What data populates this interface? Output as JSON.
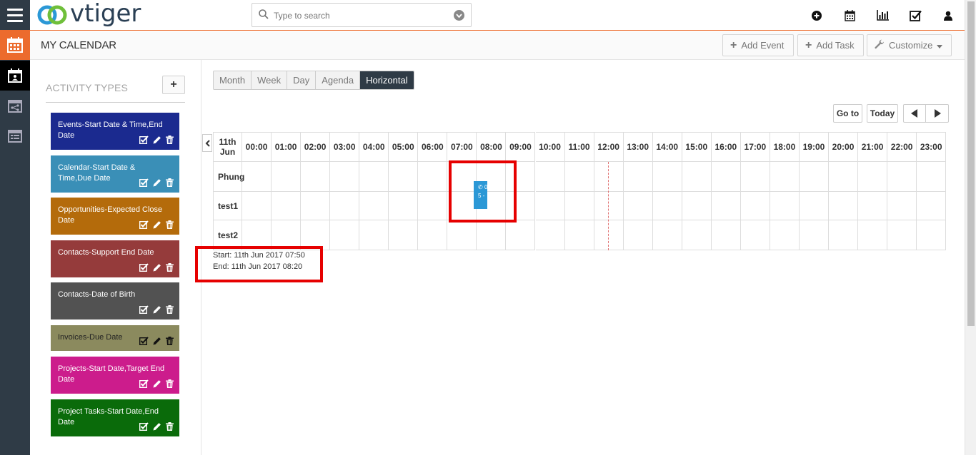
{
  "app": {
    "logo_text": "vtiger",
    "search_placeholder": "Type to search"
  },
  "page": {
    "title": "MY CALENDAR",
    "buttons": {
      "add_event": "Add Event",
      "add_task": "Add Task",
      "customize": "Customize"
    }
  },
  "activity_types": {
    "title": "ACTIVITY TYPES",
    "add_label": "+",
    "items": [
      {
        "label": "Events-Start Date & Time,End Date",
        "color": "#1b2a8f"
      },
      {
        "label": "Calendar-Start Date & Time,Due Date",
        "color": "#3a8fb7"
      },
      {
        "label": "Opportunities-Expected Close Date",
        "color": "#b46b0b"
      },
      {
        "label": "Contacts-Support End Date",
        "color": "#953b3b"
      },
      {
        "label": "Contacts-Date of Birth",
        "color": "#525252"
      },
      {
        "label": "Invoices-Due Date",
        "color": "#8b8a5e"
      },
      {
        "label": "Projects-Start Date,Target End Date",
        "color": "#cc1c8c"
      },
      {
        "label": "Project Tasks-Start Date,End Date",
        "color": "#0a6b0a"
      }
    ]
  },
  "views": {
    "tabs": [
      "Month",
      "Week",
      "Day",
      "Agenda",
      "Horizontal"
    ],
    "active": "Horizontal"
  },
  "navigation": {
    "goto": "Go to",
    "today": "Today"
  },
  "timeline": {
    "date_label": "11th Jun",
    "hours": [
      "00:00",
      "01:00",
      "02:00",
      "03:00",
      "04:00",
      "05:00",
      "06:00",
      "07:00",
      "08:00",
      "09:00",
      "10:00",
      "11:00",
      "12:00",
      "13:00",
      "14:00",
      "15:00",
      "16:00",
      "17:00",
      "18:00",
      "19:00",
      "20:00",
      "21:00",
      "22:00",
      "23:00"
    ],
    "rows": [
      "Phung",
      "test1",
      "test2"
    ],
    "event": {
      "text_line1": "0",
      "text_line2": "5 -"
    }
  },
  "tooltip": {
    "start": "Start: 11th Jun 2017 07:50",
    "end": "End: 11th Jun 2017 08:20"
  }
}
